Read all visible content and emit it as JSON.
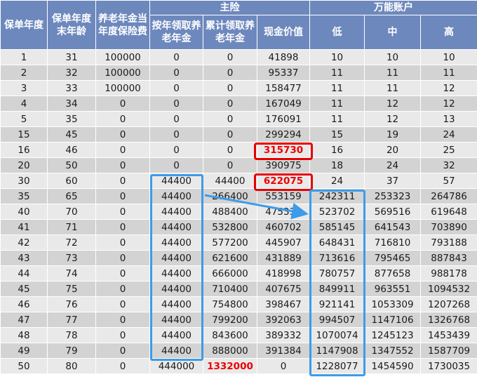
{
  "header": {
    "policy_year": "保单年度",
    "age": "保单年度末年龄",
    "premium": "养老年金当年度保险费",
    "main_group": "主险",
    "annual_annuity": "按年领取养老年金",
    "cumulative_annuity": "累计领取养老年金",
    "cash_value": "现金价值",
    "universal_group": "万能账户",
    "low": "低",
    "mid": "中",
    "high": "高"
  },
  "colors": {
    "header_bg": "#6d88bd",
    "highlight_red": "#ee0000",
    "box_blue": "#3d9be9"
  },
  "rows": [
    [
      "1",
      "31",
      "100000",
      "0",
      "0",
      "41898",
      "10",
      "10",
      "10"
    ],
    [
      "2",
      "32",
      "100000",
      "0",
      "0",
      "95337",
      "11",
      "11",
      "11"
    ],
    [
      "3",
      "33",
      "100000",
      "0",
      "0",
      "158477",
      "11",
      "11",
      "12"
    ],
    [
      "4",
      "34",
      "0",
      "0",
      "0",
      "167049",
      "11",
      "12",
      "12"
    ],
    [
      "5",
      "35",
      "0",
      "0",
      "0",
      "176091",
      "11",
      "12",
      "13"
    ],
    [
      "15",
      "45",
      "0",
      "0",
      "0",
      "299294",
      "15",
      "19",
      "24"
    ],
    [
      "16",
      "46",
      "0",
      "0",
      "0",
      "315730",
      "16",
      "20",
      "25"
    ],
    [
      "20",
      "50",
      "0",
      "0",
      "0",
      "390975",
      "18",
      "24",
      "32"
    ],
    [
      "30",
      "60",
      "0",
      "44400",
      "44400",
      "622075",
      "24",
      "37",
      "57"
    ],
    [
      "35",
      "65",
      "0",
      "44400",
      "266400",
      "553159",
      "242311",
      "253323",
      "264786"
    ],
    [
      "40",
      "70",
      "0",
      "44400",
      "488400",
      "475330",
      "523702",
      "569516",
      "619648"
    ],
    [
      "41",
      "71",
      "0",
      "44400",
      "532800",
      "460702",
      "585145",
      "641543",
      "703890"
    ],
    [
      "42",
      "72",
      "0",
      "44400",
      "577200",
      "445907",
      "648431",
      "716810",
      "793188"
    ],
    [
      "43",
      "73",
      "0",
      "44400",
      "621600",
      "431889",
      "713616",
      "795465",
      "887843"
    ],
    [
      "44",
      "74",
      "0",
      "44400",
      "666000",
      "418998",
      "780757",
      "877658",
      "988178"
    ],
    [
      "45",
      "75",
      "0",
      "44400",
      "710400",
      "407675",
      "849911",
      "963551",
      "1094532"
    ],
    [
      "46",
      "76",
      "0",
      "44400",
      "754800",
      "398467",
      "921141",
      "1053309",
      "1207268"
    ],
    [
      "47",
      "77",
      "0",
      "44400",
      "799200",
      "392063",
      "994507",
      "1147106",
      "1326768"
    ],
    [
      "48",
      "78",
      "0",
      "44400",
      "843600",
      "389332",
      "1070074",
      "1245123",
      "1453439"
    ],
    [
      "49",
      "79",
      "0",
      "44400",
      "888000",
      "391384",
      "1147908",
      "1347552",
      "1587709"
    ],
    [
      "50",
      "80",
      "0",
      "444000",
      "1332000",
      "0",
      "1228077",
      "1454590",
      "1730035"
    ]
  ],
  "highlights": [
    {
      "row": 6,
      "col": 5
    },
    {
      "row": 8,
      "col": 5
    },
    {
      "row": 20,
      "col": 4
    }
  ]
}
